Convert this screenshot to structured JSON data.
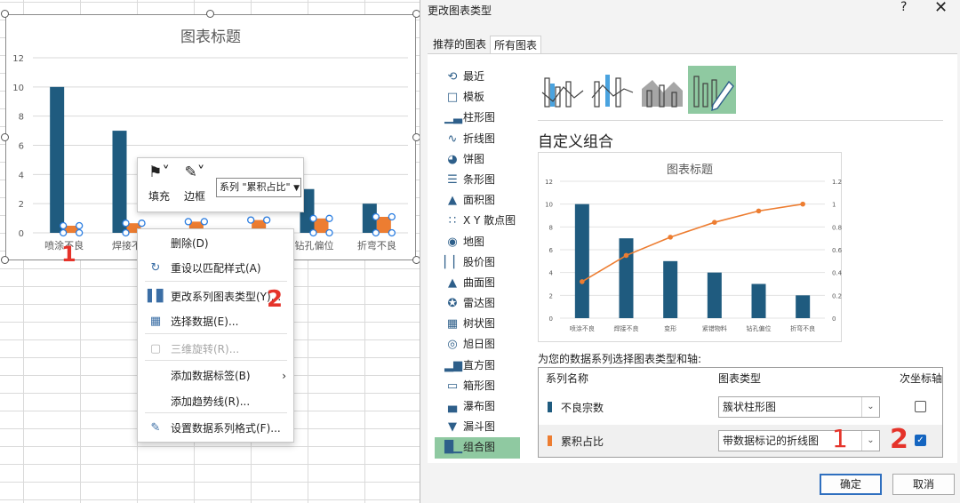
{
  "excel": {
    "chart": {
      "title": "图表标题",
      "categories": [
        "喷涂不良",
        "焊接不良",
        "变形",
        "紧错物料",
        "钻孔偏位",
        "折弯不良"
      ],
      "visible_category_labels": [
        "喷涂不良",
        "焊接不",
        "",
        "",
        "钻孔偏位",
        "折弯不良"
      ],
      "y_ticks": [
        "0",
        "2",
        "4",
        "6",
        "8",
        "10",
        "12"
      ]
    },
    "mini_toolbar": {
      "fill_label": "填充",
      "border_label": "边框",
      "series_select": "系列 \"累积占比\""
    },
    "context_menu": [
      {
        "label": "删除(D)",
        "icon": "delete-icon",
        "disabled": false
      },
      {
        "label": "重设以匹配样式(A)",
        "icon": "reset-style-icon",
        "disabled": false
      },
      {
        "label": "更改系列图表类型(Y)...",
        "icon": "change-chart-type-icon",
        "disabled": false
      },
      {
        "label": "选择数据(E)...",
        "icon": "select-data-icon",
        "disabled": false
      },
      {
        "label": "三维旋转(R)...",
        "icon": "3d-rotate-icon",
        "disabled": true
      },
      {
        "label": "添加数据标签(B)",
        "icon": "",
        "disabled": false,
        "submenu": true
      },
      {
        "label": "添加趋势线(R)...",
        "icon": "",
        "disabled": false
      },
      {
        "label": "设置数据系列格式(F)...",
        "icon": "format-series-icon",
        "disabled": false
      }
    ],
    "annotations": {
      "mark1": "1",
      "mark2": "2"
    }
  },
  "dialog": {
    "title": "更改图表类型",
    "help": "?",
    "close": "✕",
    "tabs": [
      "推荐的图表",
      "所有图表"
    ],
    "chart_types": [
      {
        "label": "最近",
        "icon": "recent-icon"
      },
      {
        "label": "模板",
        "icon": "template-icon"
      },
      {
        "label": "柱形图",
        "icon": "column-chart-icon"
      },
      {
        "label": "折线图",
        "icon": "line-chart-icon"
      },
      {
        "label": "饼图",
        "icon": "pie-chart-icon"
      },
      {
        "label": "条形图",
        "icon": "bar-chart-icon"
      },
      {
        "label": "面积图",
        "icon": "area-chart-icon"
      },
      {
        "label": "X Y 散点图",
        "icon": "scatter-chart-icon"
      },
      {
        "label": "地图",
        "icon": "map-chart-icon"
      },
      {
        "label": "股价图",
        "icon": "stock-chart-icon"
      },
      {
        "label": "曲面图",
        "icon": "surface-chart-icon"
      },
      {
        "label": "雷达图",
        "icon": "radar-chart-icon"
      },
      {
        "label": "树状图",
        "icon": "treemap-chart-icon"
      },
      {
        "label": "旭日图",
        "icon": "sunburst-chart-icon"
      },
      {
        "label": "直方图",
        "icon": "histogram-chart-icon"
      },
      {
        "label": "箱形图",
        "icon": "box-chart-icon"
      },
      {
        "label": "瀑布图",
        "icon": "waterfall-chart-icon"
      },
      {
        "label": "漏斗图",
        "icon": "funnel-chart-icon"
      },
      {
        "label": "组合图",
        "icon": "combo-chart-icon",
        "selected": true
      }
    ],
    "custom_heading": "自定义组合",
    "series_prompt": "为您的数据系列选择图表类型和轴:",
    "table_headers": {
      "name": "系列名称",
      "type": "图表类型",
      "secondary": "次坐标轴"
    },
    "series": [
      {
        "name": "不良宗数",
        "chart_type": "簇状柱形图",
        "secondary_axis": false,
        "color": "#1f5b7f"
      },
      {
        "name": "累积占比",
        "chart_type": "带数据标记的折线图",
        "secondary_axis": true,
        "color": "#ed7d31"
      }
    ],
    "ok_button": "确定",
    "cancel_button": "取消",
    "annotations": {
      "mark1": "1",
      "mark2": "2"
    }
  },
  "colors": {
    "bar": "#1f5b7f",
    "line": "#ed7d31",
    "selected": "#8fc9a1"
  },
  "chart_data": [
    {
      "type": "bar",
      "title": "图表标题",
      "categories": [
        "喷涂不良",
        "焊接不良",
        "变形",
        "紧错物料",
        "钻孔偏位",
        "折弯不良"
      ],
      "series": [
        {
          "name": "不良宗数",
          "type": "bar",
          "values": [
            10,
            7,
            null,
            null,
            3,
            2
          ]
        },
        {
          "name": "累积占比",
          "type": "bar",
          "values": [
            0.3,
            0.6,
            0.7,
            0.8,
            0.9,
            1.0
          ]
        }
      ],
      "ylim": [
        0,
        12
      ],
      "grid": true
    },
    {
      "type": "bar",
      "title": "图表标题",
      "categories": [
        "喷涂不良",
        "焊接不良",
        "变形",
        "紧错物料",
        "钻孔偏位",
        "折弯不良"
      ],
      "series": [
        {
          "name": "不良宗数",
          "type": "bar",
          "axis": "primary",
          "values": [
            10,
            7,
            5,
            4,
            3,
            2
          ]
        },
        {
          "name": "累积占比",
          "type": "line",
          "axis": "secondary",
          "values": [
            0.32,
            0.55,
            0.71,
            0.84,
            0.94,
            1.0
          ]
        }
      ],
      "ylim": [
        0,
        12
      ],
      "y2lim": [
        0,
        1.2
      ],
      "y_ticks": [
        "0",
        "2",
        "4",
        "6",
        "8",
        "10",
        "12"
      ],
      "y2_ticks": [
        "0",
        "0.2",
        "0.4",
        "0.6",
        "0.8",
        "1",
        "1.2"
      ],
      "grid": true
    }
  ]
}
